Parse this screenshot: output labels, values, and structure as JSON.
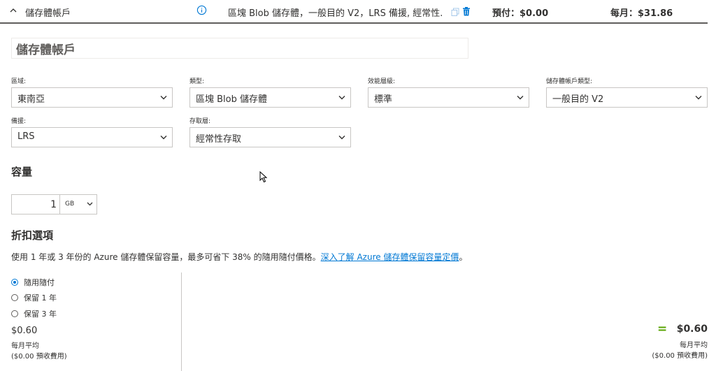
{
  "header": {
    "title": "儲存體帳戶",
    "description": "區塊 Blob 儲存體，一般目的 V2，LRS 備援, 經常性...",
    "upfront": "預付：$0.00",
    "monthly": "每月：$31.86"
  },
  "name_input": {
    "value": "儲存體帳戶"
  },
  "fields": {
    "region": {
      "label": "區域:",
      "value": "東南亞"
    },
    "type": {
      "label": "類型:",
      "value": "區塊 Blob 儲存體"
    },
    "performance": {
      "label": "效能層級:",
      "value": "標準"
    },
    "account_type": {
      "label": "儲存體帳戶類型:",
      "value": "一般目的 V2"
    },
    "redundancy": {
      "label": "備援:",
      "value": "LRS"
    },
    "access_tier": {
      "label": "存取層:",
      "value": "經常性存取"
    }
  },
  "capacity": {
    "title": "容量",
    "quantity": "1",
    "unit": "GB"
  },
  "discount": {
    "title": "折扣選項",
    "description": "使用 1 年或 3 年份的 Azure 儲存體保留容量，最多可省下 38% 的隨用隨付價格。",
    "link": "深入了解 Azure 儲存體保留容量定價",
    "tail": "。",
    "options": [
      "隨用隨付",
      "保留 1 年",
      "保留 3 年"
    ],
    "selected_index": 0
  },
  "summary": {
    "left_price": "$0.60",
    "left_sub1": "每月平均",
    "left_sub2": "($0.00 預收費用)",
    "equals": "=",
    "right_price": "$0.60",
    "right_sub1": "每月平均",
    "right_sub2": "($0.00 預收費用)"
  },
  "colors": {
    "accent": "#0078d4",
    "equals": "#57a300",
    "border": "#c8c6c4"
  },
  "icons": [
    "chevron-up-icon",
    "info-icon",
    "copy-icon",
    "delete-icon",
    "chevron-down-icon",
    "mouse-cursor-icon"
  ]
}
